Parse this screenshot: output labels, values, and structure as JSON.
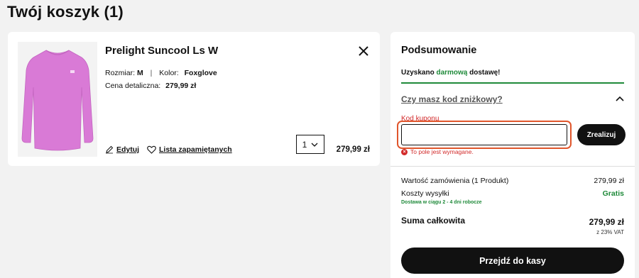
{
  "page": {
    "title": "Twój koszyk (1)"
  },
  "cart": {
    "item": {
      "name": "Prelight Suncool Ls W",
      "size_label": "Rozmiar:",
      "size_value": "M",
      "separator": "|",
      "color_label": "Kolor:",
      "color_value": "Foxglove",
      "retail_label": "Cena detaliczna:",
      "retail_value": "279,99 zł",
      "edit_label": "Edytuj",
      "wishlist_label": "Lista zapamiętanych",
      "quantity": "1",
      "line_total": "279,99 zł",
      "shirt_color": "#d97ad6"
    }
  },
  "summary": {
    "title": "Podsumowanie",
    "shipping_pre": "Uzyskano ",
    "shipping_free_word": "darmową",
    "shipping_post": " dostawę!",
    "discount_toggle": "Czy masz kod zniżkowy?",
    "coupon_label": "Kod kuponu",
    "coupon_value": "",
    "redeem_label": "Zrealizuj",
    "error_text": "To pole jest wymagane.",
    "order_value_label": "Wartość zamówienia (1 Produkt)",
    "order_value": "279,99 zł",
    "shipping_cost_label": "Koszty wysyłki",
    "shipping_cost_value": "Gratis",
    "delivery_note": "Dostawa w ciągu 2 - 4 dni robocze",
    "total_label": "Suma całkowita",
    "total_value": "279,99 zł",
    "vat_note": "z 23% VAT",
    "checkout_label": "Przejdź do kasy"
  },
  "colors": {
    "accent_green": "#1f8a3a",
    "error_red": "#d22a2a",
    "focus_outline": "#e0562c"
  }
}
